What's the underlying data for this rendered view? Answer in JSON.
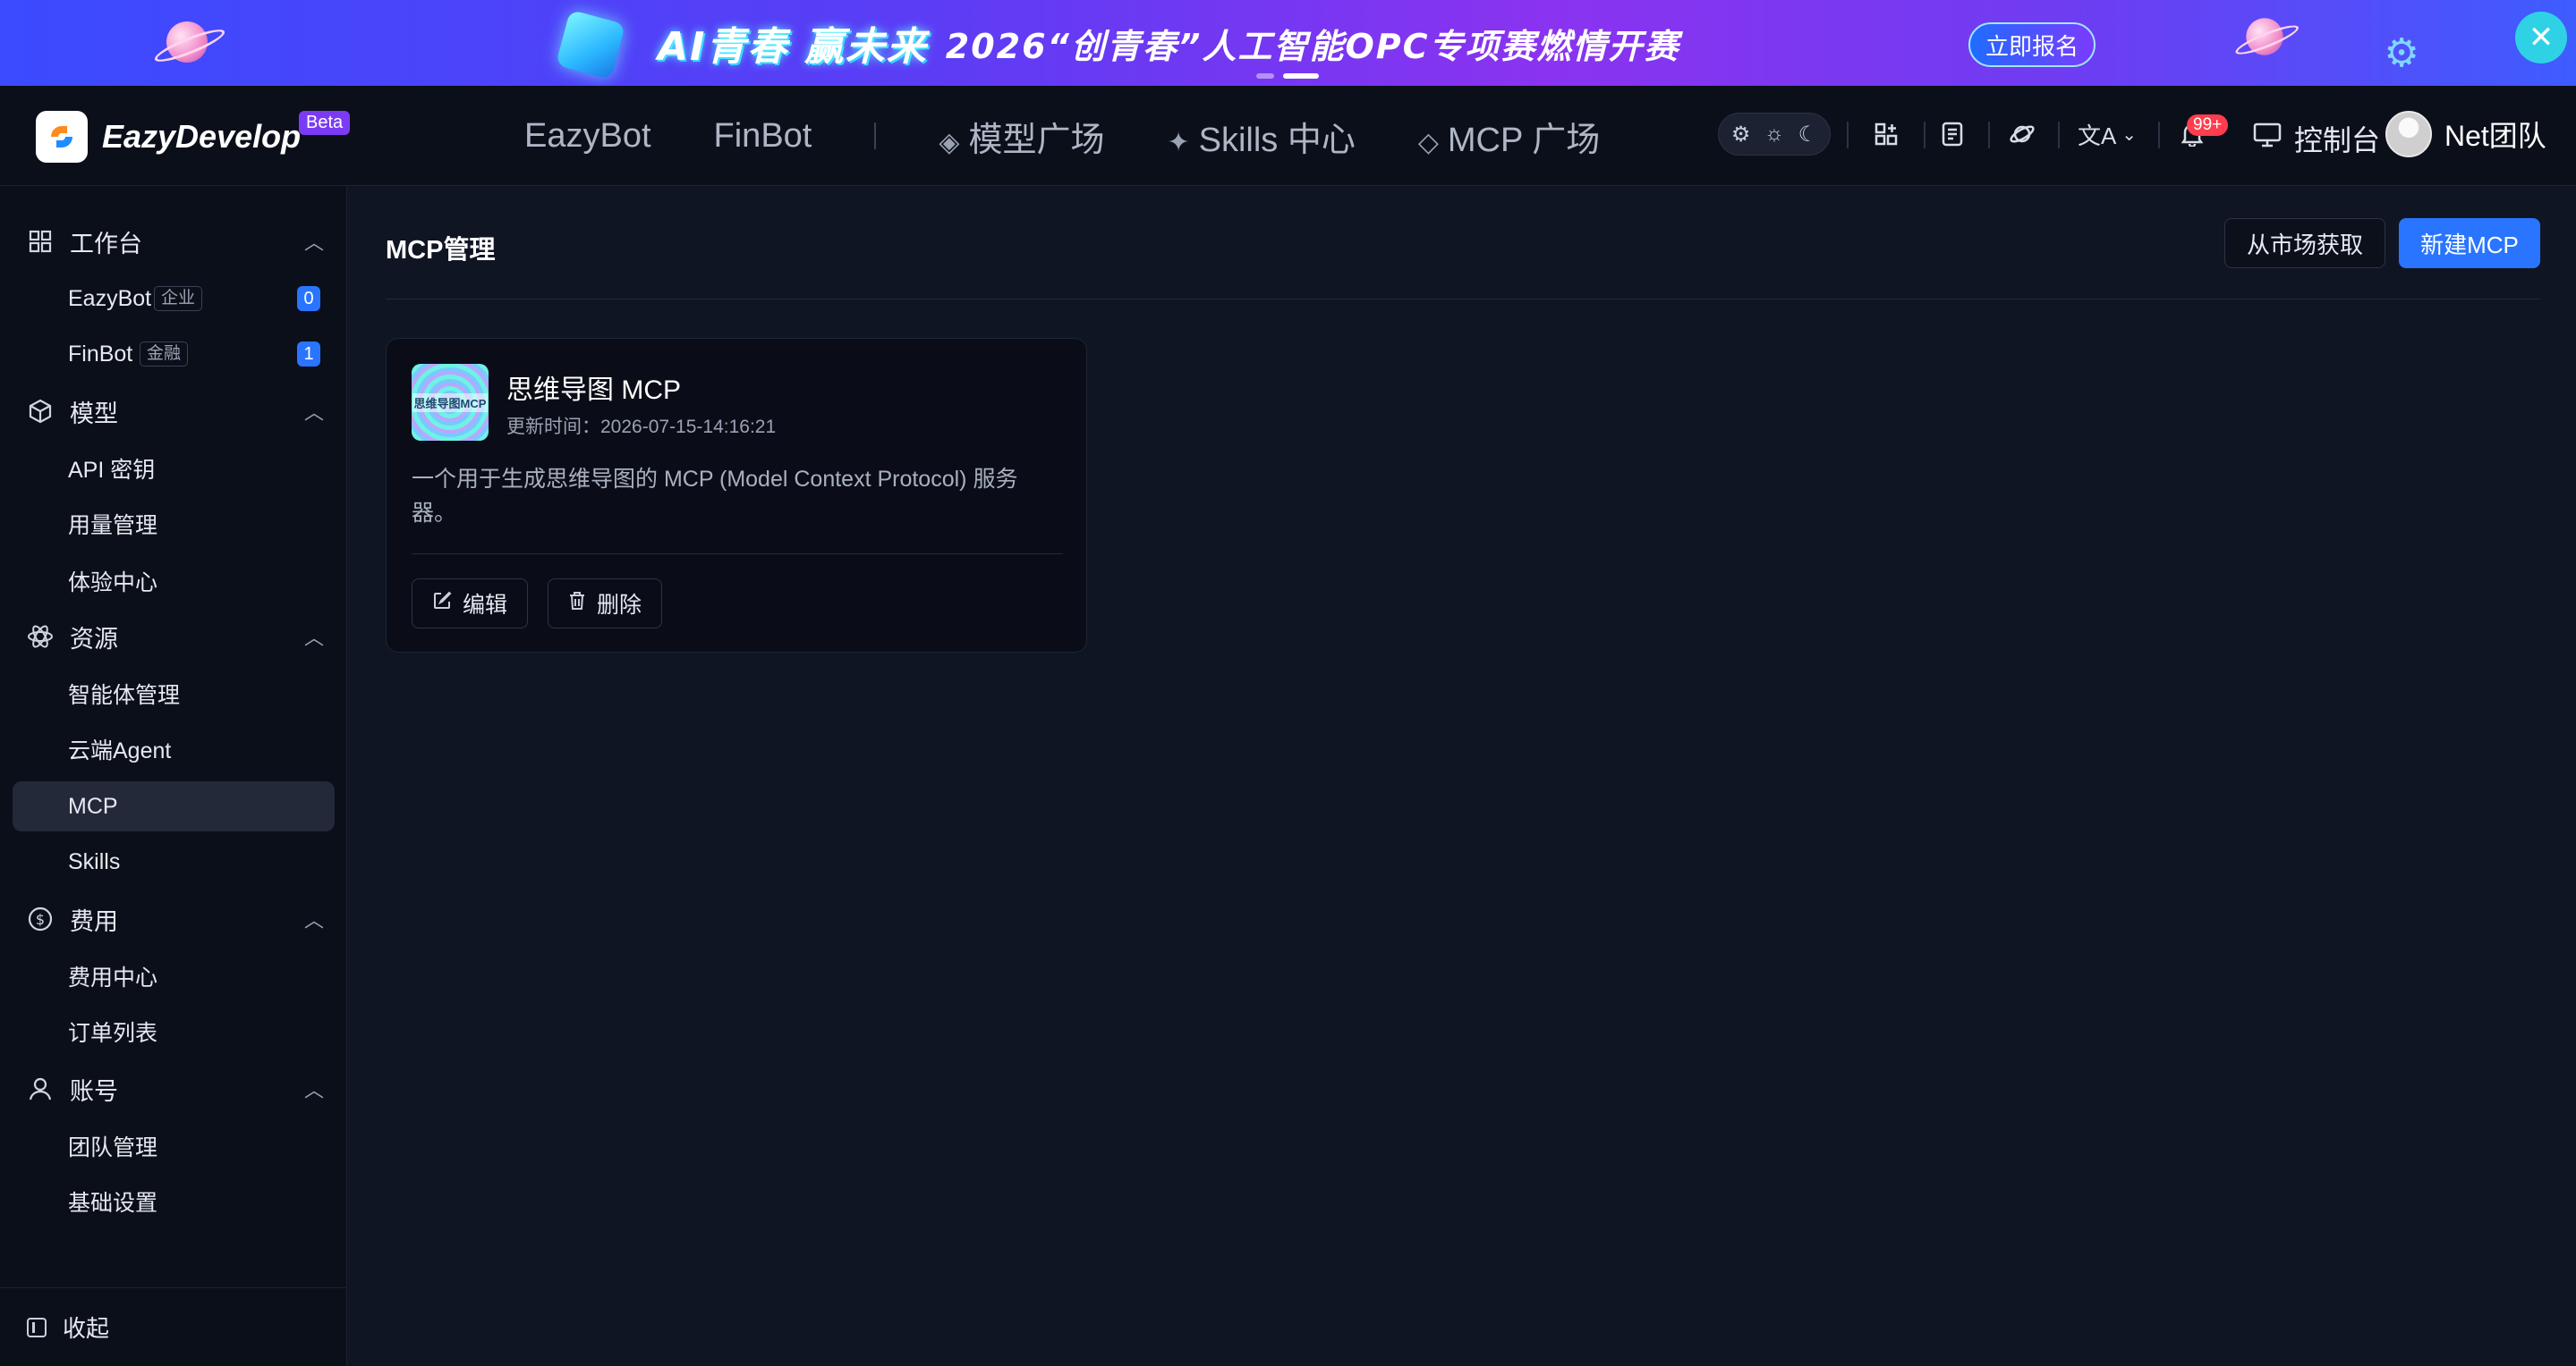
{
  "banner": {
    "headline_a": "AI青春 赢未来",
    "headline_b": "2026“创青春”人工智能OPC专项赛燃情开赛",
    "signup_label": "立即报名",
    "close_icon": "close-icon"
  },
  "topnav": {
    "brand": "EazyDevelop",
    "beta": "Beta",
    "links": [
      "EazyBot",
      "FinBot",
      "模型广场",
      "Skills 中心",
      "MCP 广场"
    ],
    "notif_count": "99+",
    "console_label": "控制台",
    "user_name": "Net团队"
  },
  "sidebar": {
    "groups": [
      {
        "label": "工作台",
        "icon": "grid-icon"
      },
      {
        "label": "模型",
        "icon": "cube-icon"
      },
      {
        "label": "资源",
        "icon": "atom-icon"
      },
      {
        "label": "费用",
        "icon": "dollar-icon"
      },
      {
        "label": "账号",
        "icon": "user-icon"
      }
    ],
    "items": {
      "eazybot": {
        "label": "EazyBot",
        "tag": "企业",
        "count": "0"
      },
      "finbot": {
        "label": "FinBot",
        "tag": "金融",
        "count": "1"
      },
      "api_key": "API 密钥",
      "usage": "用量管理",
      "experience": "体验中心",
      "agents": "智能体管理",
      "cloud_agent": "云端Agent",
      "mcp": "MCP",
      "skills": "Skills",
      "billing": "费用中心",
      "orders": "订单列表",
      "team": "团队管理",
      "settings": "基础设置"
    },
    "collapse_label": "收起"
  },
  "main": {
    "title": "MCP管理",
    "market_button": "从市场获取",
    "new_button": "新建MCP",
    "cards": [
      {
        "thumb_text": "思维导图MCP",
        "title": "思维导图 MCP",
        "updated": "更新时间：2026-07-15-14:16:21",
        "description": "一个用于生成思维导图的 MCP (Model Context Protocol) 服务器。",
        "edit_label": "编辑",
        "delete_label": "删除"
      }
    ]
  },
  "colors": {
    "accent": "#2a75ff",
    "background": "#101524",
    "sidebar_bg": "#0b0f1a",
    "badge_red": "#ff3d4e",
    "beta_purple": "#7b3bf4"
  }
}
